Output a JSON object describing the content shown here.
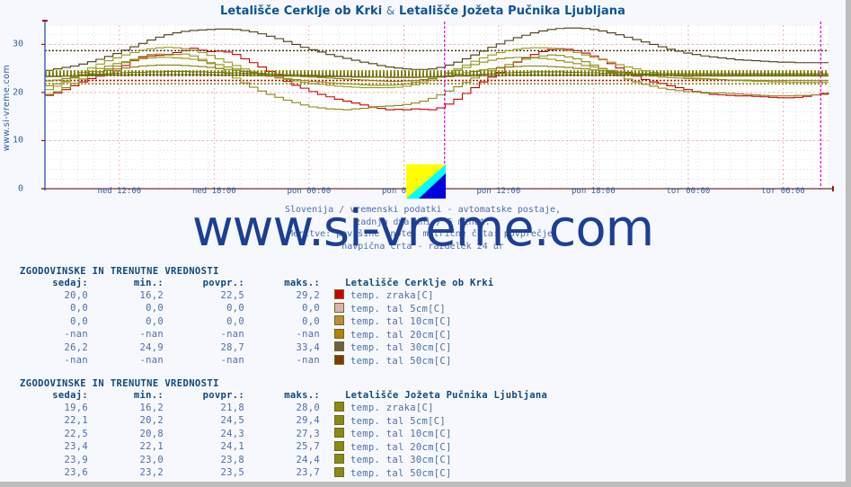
{
  "title": {
    "station_a": "Letališče Cerklje ob Krki",
    "separator": "&",
    "station_b": "Letališče Jožeta Pučnika Ljubljana"
  },
  "watermark": {
    "side": "www.si-vreme.com",
    "main": "www.si-vreme.com"
  },
  "caption": {
    "line1": "Slovenija / vremenski podatki - avtomatske postaje,",
    "line2": "zadnja dva dni / 5 minut.",
    "line3": "Meritve: površine enote: matrične črta: povprečje,",
    "line4": "navpična črta - razdelek 24 ur"
  },
  "chart_data": {
    "type": "line",
    "title": "Letališče Cerklje ob Krki & Letališče Jožeta Pučnika Ljubljana",
    "xlabel": "",
    "ylabel": "",
    "ylim": [
      0,
      34
    ],
    "yticks": [
      0,
      10,
      20,
      30
    ],
    "grid": true,
    "legend_position": "below-table",
    "xticklabels": [
      "ned 12:00",
      "ned 18:00",
      "pon 00:00",
      "pon 06:00",
      "pon 12:00",
      "pon 18:00",
      "tor 00:00",
      "tor 06:00"
    ],
    "xtick_positions_pct": [
      9.5,
      21.6,
      33.7,
      45.8,
      57.9,
      70.0,
      82.1,
      94.2
    ],
    "vertical_divider_pct": [
      51.0,
      99.0
    ],
    "series": [
      {
        "name": "Cerklje temp. zraka[C]",
        "color": "#cc0000",
        "avg_line": 22.5,
        "values": [
          19.4,
          19.9,
          20.6,
          21.4,
          22.2,
          22.9,
          23.4,
          23.9,
          24.5,
          25.6,
          26.6,
          27.3,
          27.6,
          27.7,
          27.9,
          28.3,
          28.7,
          29.2,
          28.8,
          28.5,
          28.6,
          28.4,
          27.9,
          27.0,
          26.2,
          25.3,
          24.4,
          23.4,
          22.3,
          21.5,
          20.9,
          20.2,
          19.6,
          19.1,
          18.6,
          18.2,
          17.8,
          17.4,
          17.0,
          16.7,
          16.4,
          16.5,
          16.4,
          16.6,
          16.5,
          16.4,
          16.8,
          17.6,
          18.6,
          19.8,
          21.0,
          22.2,
          23.2,
          24.2,
          25.3,
          26.3,
          27.2,
          27.9,
          28.5,
          28.9,
          29.1,
          29.0,
          28.7,
          28.2,
          27.6,
          26.9,
          26.0,
          25.1,
          24.2,
          23.4,
          22.7,
          22.2,
          21.9,
          21.4,
          21.0,
          20.6,
          20.2,
          19.9,
          19.6,
          19.5,
          19.4,
          19.3,
          19.3,
          19.2,
          19.1,
          19.0,
          18.9,
          18.9,
          19.0,
          19.2,
          19.5,
          19.8,
          20.0
        ]
      },
      {
        "name": "Cerklje temp. tal 30cm[C]",
        "color": "#4a3b12",
        "avg_line": 28.7,
        "values": [
          24.6,
          24.9,
          25.2,
          25.5,
          25.9,
          26.4,
          26.9,
          27.5,
          28.1,
          28.8,
          29.5,
          30.2,
          30.9,
          31.5,
          32.0,
          32.4,
          32.7,
          32.9,
          33.0,
          33.1,
          33.2,
          33.2,
          33.1,
          32.9,
          32.6,
          32.2,
          31.7,
          31.2,
          30.6,
          30.0,
          29.4,
          28.9,
          28.4,
          27.9,
          27.5,
          27.1,
          26.7,
          26.3,
          26.0,
          25.6,
          25.3,
          25.1,
          24.9,
          24.8,
          24.8,
          24.9,
          25.2,
          25.7,
          26.3,
          27.0,
          27.8,
          28.6,
          29.4,
          30.1,
          30.8,
          31.4,
          31.9,
          32.4,
          32.8,
          33.1,
          33.3,
          33.4,
          33.4,
          33.3,
          33.1,
          32.8,
          32.4,
          32.0,
          31.5,
          31.0,
          30.5,
          30.0,
          29.5,
          29.0,
          28.6,
          28.2,
          27.9,
          27.6,
          27.4,
          27.2,
          27.0,
          26.8,
          26.7,
          26.6,
          26.5,
          26.4,
          26.3,
          26.3,
          26.2,
          26.2,
          26.2,
          26.2,
          26.2
        ]
      },
      {
        "name": "Ljubljana temp. zraka[C]",
        "color": "#8a8a14",
        "avg_line": 21.8,
        "values": [
          19.6,
          20.2,
          21.0,
          21.9,
          22.8,
          23.6,
          24.3,
          24.9,
          25.5,
          26.2,
          26.9,
          27.5,
          27.9,
          28.0,
          27.8,
          27.9,
          28.0,
          27.6,
          26.9,
          26.0,
          25.0,
          24.0,
          23.0,
          22.0,
          21.1,
          20.3,
          19.6,
          19.0,
          18.4,
          17.9,
          17.4,
          17.0,
          16.8,
          16.6,
          16.5,
          16.4,
          16.6,
          16.7,
          16.9,
          17.1,
          17.2,
          17.3,
          17.5,
          17.8,
          18.2,
          18.8,
          19.5,
          20.3,
          21.2,
          22.1,
          23.0,
          23.8,
          24.5,
          25.2,
          25.8,
          26.4,
          26.9,
          27.3,
          27.6,
          27.8,
          27.7,
          27.4,
          27.0,
          26.4,
          25.7,
          25.0,
          24.2,
          23.5,
          22.8,
          22.2,
          21.7,
          21.3,
          20.9,
          20.6,
          20.4,
          20.2,
          20.1,
          20.0,
          19.9,
          19.9,
          19.8,
          19.7,
          19.6,
          19.5,
          19.4,
          19.3,
          19.3,
          19.3,
          19.4,
          19.4,
          19.5,
          19.6,
          19.6
        ]
      },
      {
        "name": "Ljubljana temp. tal 5cm[C]",
        "color": "#9a9a1e",
        "avg_line": 24.5,
        "values": [
          20.6,
          21.3,
          22.2,
          23.2,
          24.2,
          25.1,
          25.9,
          26.6,
          27.2,
          27.8,
          28.3,
          28.8,
          29.1,
          29.3,
          29.4,
          29.3,
          29.1,
          28.8,
          28.3,
          27.7,
          27.0,
          26.3,
          25.6,
          24.9,
          24.3,
          23.8,
          23.4,
          23.0,
          22.7,
          22.4,
          22.1,
          21.9,
          21.7,
          21.5,
          21.3,
          21.2,
          21.1,
          21.0,
          21.0,
          21.0,
          21.0,
          21.1,
          21.3,
          21.6,
          22.0,
          22.6,
          23.3,
          24.1,
          24.9,
          25.7,
          26.5,
          27.2,
          27.8,
          28.3,
          28.7,
          29.0,
          29.2,
          29.3,
          29.3,
          29.2,
          29.0,
          28.7,
          28.3,
          27.8,
          27.3,
          26.8,
          26.3,
          25.8,
          25.3,
          24.9,
          24.5,
          24.2,
          23.9,
          23.6,
          23.4,
          23.2,
          23.0,
          22.9,
          22.8,
          22.7,
          22.6,
          22.5,
          22.4,
          22.3,
          22.3,
          22.2,
          22.2,
          22.1,
          22.1,
          22.1,
          22.1,
          22.1,
          22.1
        ]
      },
      {
        "name": "Ljubljana temp. tal 10cm[C]",
        "color": "#8f8f16",
        "avg_line": 24.3,
        "values": [
          21.4,
          21.8,
          22.4,
          23.0,
          23.7,
          24.4,
          25.0,
          25.5,
          26.0,
          26.4,
          26.7,
          27.0,
          27.2,
          27.3,
          27.3,
          27.2,
          27.1,
          26.9,
          26.6,
          26.2,
          25.8,
          25.3,
          24.9,
          24.4,
          24.0,
          23.7,
          23.4,
          23.1,
          22.9,
          22.7,
          22.5,
          22.3,
          22.2,
          22.0,
          21.9,
          21.8,
          21.7,
          21.6,
          21.5,
          21.5,
          21.5,
          21.6,
          21.8,
          22.1,
          22.4,
          22.9,
          23.4,
          24.0,
          24.6,
          25.2,
          25.8,
          26.3,
          26.7,
          27.0,
          27.2,
          27.3,
          27.3,
          27.2,
          27.1,
          26.9,
          26.6,
          26.3,
          26.0,
          25.6,
          25.3,
          24.9,
          24.6,
          24.3,
          24.0,
          23.8,
          23.6,
          23.4,
          23.2,
          23.1,
          23.0,
          22.9,
          22.8,
          22.8,
          22.7,
          22.7,
          22.6,
          22.6,
          22.6,
          22.5,
          22.5,
          22.5,
          22.5,
          22.5,
          22.5,
          22.5,
          22.5,
          22.5,
          22.5
        ]
      },
      {
        "name": "Ljubljana temp. tal 20cm[C]",
        "color": "#7f7f12",
        "avg_line": 24.1,
        "values": [
          22.4,
          22.6,
          22.9,
          23.2,
          23.6,
          23.9,
          24.3,
          24.6,
          24.9,
          25.1,
          25.3,
          25.5,
          25.6,
          25.7,
          25.7,
          25.7,
          25.6,
          25.5,
          25.4,
          25.2,
          25.0,
          24.8,
          24.6,
          24.4,
          24.2,
          24.0,
          23.8,
          23.7,
          23.5,
          23.4,
          23.3,
          23.2,
          23.1,
          23.0,
          22.9,
          22.8,
          22.7,
          22.6,
          22.5,
          22.4,
          22.3,
          22.3,
          22.4,
          22.5,
          22.7,
          22.9,
          23.2,
          23.5,
          23.8,
          24.1,
          24.4,
          24.7,
          24.9,
          25.1,
          25.3,
          25.4,
          25.5,
          25.5,
          25.5,
          25.4,
          25.3,
          25.2,
          25.0,
          24.9,
          24.7,
          24.5,
          24.4,
          24.2,
          24.1,
          23.9,
          23.8,
          23.7,
          23.6,
          23.6,
          23.5,
          23.5,
          23.4,
          23.4,
          23.4,
          23.4,
          23.4,
          23.4,
          23.4,
          23.4,
          23.4,
          23.4,
          23.4,
          23.4,
          23.4,
          23.4,
          23.4,
          23.4,
          23.4
        ]
      },
      {
        "name": "Ljubljana temp. tal 30cm[C]",
        "color": "#74740f",
        "avg_line": 23.8,
        "values": [
          23.3,
          23.3,
          23.4,
          23.5,
          23.6,
          23.7,
          23.8,
          23.9,
          24.0,
          24.1,
          24.2,
          24.2,
          24.3,
          24.3,
          24.4,
          24.4,
          24.4,
          24.3,
          24.3,
          24.2,
          24.2,
          24.1,
          24.1,
          24.0,
          23.9,
          23.9,
          23.8,
          23.8,
          23.7,
          23.7,
          23.6,
          23.6,
          23.5,
          23.5,
          23.4,
          23.4,
          23.3,
          23.3,
          23.2,
          23.2,
          23.1,
          23.1,
          23.1,
          23.1,
          23.2,
          23.2,
          23.3,
          23.4,
          23.5,
          23.6,
          23.7,
          23.8,
          23.9,
          24.0,
          24.1,
          24.2,
          24.2,
          24.3,
          24.3,
          24.3,
          24.3,
          24.2,
          24.2,
          24.1,
          24.1,
          24.0,
          24.0,
          23.9,
          23.9,
          23.9,
          23.9,
          23.9,
          23.9,
          23.9,
          23.9,
          23.9,
          23.9,
          23.9,
          23.9,
          23.9,
          23.9,
          23.9,
          23.9,
          23.9,
          23.9,
          23.9,
          23.9,
          23.9,
          23.9,
          23.9,
          23.9,
          23.9,
          23.9
        ]
      },
      {
        "name": "Ljubljana temp. tal 50cm[C]",
        "color": "#6b6b0e",
        "avg_line": 23.5,
        "values": [
          23.4,
          23.4,
          23.4,
          23.5,
          23.5,
          23.5,
          23.6,
          23.6,
          23.6,
          23.6,
          23.7,
          23.7,
          23.7,
          23.7,
          23.7,
          23.7,
          23.7,
          23.7,
          23.7,
          23.7,
          23.6,
          23.6,
          23.6,
          23.6,
          23.5,
          23.5,
          23.5,
          23.5,
          23.4,
          23.4,
          23.4,
          23.4,
          23.3,
          23.3,
          23.3,
          23.3,
          23.2,
          23.2,
          23.2,
          23.2,
          23.2,
          23.2,
          23.2,
          23.2,
          23.2,
          23.3,
          23.3,
          23.3,
          23.4,
          23.4,
          23.4,
          23.5,
          23.5,
          23.5,
          23.6,
          23.6,
          23.6,
          23.6,
          23.6,
          23.6,
          23.6,
          23.6,
          23.6,
          23.6,
          23.6,
          23.6,
          23.6,
          23.6,
          23.6,
          23.6,
          23.6,
          23.6,
          23.6,
          23.6,
          23.6,
          23.6,
          23.6,
          23.6,
          23.6,
          23.6,
          23.6,
          23.6,
          23.6,
          23.6,
          23.6,
          23.6,
          23.6,
          23.6,
          23.6,
          23.6,
          23.6,
          23.6,
          23.6
        ]
      }
    ]
  },
  "tables": [
    {
      "heading": "ZGODOVINSKE IN TRENUTNE VREDNOSTI",
      "columns": [
        "sedaj:",
        "min.:",
        "povpr.:",
        "maks.:"
      ],
      "station": "Letališče Cerklje ob Krki",
      "rows": [
        {
          "sedaj": "20,0",
          "min": "16,2",
          "povpr": "22,5",
          "maks": "29,2",
          "color": "#cc0000",
          "label": "temp. zraka[C]"
        },
        {
          "sedaj": "0,0",
          "min": "0,0",
          "povpr": "0,0",
          "maks": "0,0",
          "color": "#d9b3b3",
          "label": "temp. tal  5cm[C]"
        },
        {
          "sedaj": "0,0",
          "min": "0,0",
          "povpr": "0,0",
          "maks": "0,0",
          "color": "#bd8b3c",
          "label": "temp. tal 10cm[C]"
        },
        {
          "sedaj": "-nan",
          "min": "-nan",
          "povpr": "-nan",
          "maks": "-nan",
          "color": "#b57f07",
          "label": "temp. tal 20cm[C]"
        },
        {
          "sedaj": "26,2",
          "min": "24,9",
          "povpr": "28,7",
          "maks": "33,4",
          "color": "#6b6147",
          "label": "temp. tal 30cm[C]"
        },
        {
          "sedaj": "-nan",
          "min": "-nan",
          "povpr": "-nan",
          "maks": "-nan",
          "color": "#7a3d07",
          "label": "temp. tal 50cm[C]"
        }
      ]
    },
    {
      "heading": "ZGODOVINSKE IN TRENUTNE VREDNOSTI",
      "columns": [
        "sedaj:",
        "min.:",
        "povpr.:",
        "maks.:"
      ],
      "station": "Letališče Jožeta Pučnika Ljubljana",
      "rows": [
        {
          "sedaj": "19,6",
          "min": "16,2",
          "povpr": "21,8",
          "maks": "28,0",
          "color": "#8a8a14",
          "label": "temp. zraka[C]"
        },
        {
          "sedaj": "22,1",
          "min": "20,2",
          "povpr": "24,5",
          "maks": "29,4",
          "color": "#8a8a14",
          "label": "temp. tal  5cm[C]"
        },
        {
          "sedaj": "22,5",
          "min": "20,8",
          "povpr": "24,3",
          "maks": "27,3",
          "color": "#8a8a14",
          "label": "temp. tal 10cm[C]"
        },
        {
          "sedaj": "23,4",
          "min": "22,1",
          "povpr": "24,1",
          "maks": "25,7",
          "color": "#8a8a14",
          "label": "temp. tal 20cm[C]"
        },
        {
          "sedaj": "23,9",
          "min": "23,0",
          "povpr": "23,8",
          "maks": "24,4",
          "color": "#8a8a14",
          "label": "temp. tal 30cm[C]"
        },
        {
          "sedaj": "23,6",
          "min": "23,2",
          "povpr": "23,5",
          "maks": "23,7",
          "color": "#8a8a14",
          "label": "temp. tal 50cm[C]"
        }
      ]
    }
  ]
}
